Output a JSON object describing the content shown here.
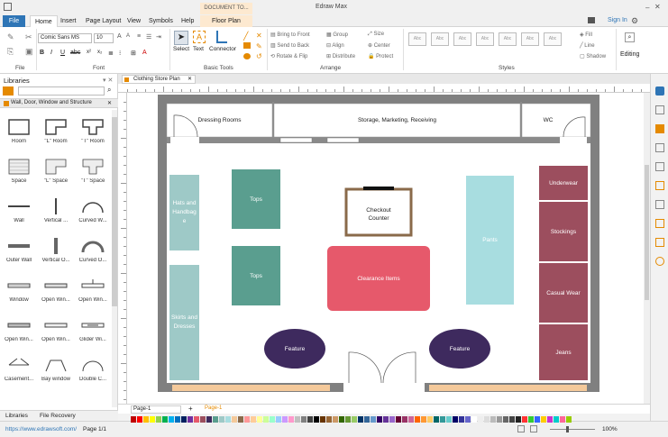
{
  "app": {
    "title": "Edraw Max",
    "context_title": "DOCUMENT TO...",
    "sign_in": "Sign In"
  },
  "menu": {
    "tabs": [
      "File",
      "Home",
      "Insert",
      "Page Layout",
      "View",
      "Symbols",
      "Help",
      "Floor Plan"
    ]
  },
  "ribbon": {
    "font_family": "Comic Sans MS",
    "font_size": "10",
    "tools": {
      "select": "Select",
      "text": "Text",
      "connector": "Connector"
    },
    "arrange": {
      "bring_to_front": "Bring to Front",
      "send_to_back": "Send to Back",
      "rotate_flip": "Rotate & Flip",
      "group": "Group",
      "align": "Align",
      "distribute": "Distribute",
      "size": "Size",
      "center": "Center",
      "protect": "Protect"
    },
    "styles": {
      "fill": "Fill",
      "line": "Line",
      "shadow": "Shadow",
      "style_label": "Abc"
    },
    "editing": "Editing",
    "groups": {
      "file": "File",
      "font": "Font",
      "basic_tools": "Basic Tools",
      "arrange": "Arrange",
      "styles": "Styles"
    }
  },
  "library": {
    "title": "Libraries",
    "category": "Wall, Door, Window and Structure",
    "shapes": [
      {
        "label": "Room"
      },
      {
        "label": "\"L\" Room"
      },
      {
        "label": "\"T\" Room"
      },
      {
        "label": "Space"
      },
      {
        "label": "\"L\" Space"
      },
      {
        "label": "\"T\" Space"
      },
      {
        "label": "Wall"
      },
      {
        "label": "Vertical ..."
      },
      {
        "label": "Curved W..."
      },
      {
        "label": "Outer Wall"
      },
      {
        "label": "Vertical O..."
      },
      {
        "label": "Curved O..."
      },
      {
        "label": "Window"
      },
      {
        "label": "Open Win..."
      },
      {
        "label": "Open Win..."
      },
      {
        "label": "Open Win..."
      },
      {
        "label": "Open Win..."
      },
      {
        "label": "Glider Wi..."
      },
      {
        "label": "Casement..."
      },
      {
        "label": "Bay window"
      },
      {
        "label": "Double C..."
      }
    ],
    "bottom_tabs": {
      "libraries": "Libraries",
      "file_recovery": "File Recovery"
    }
  },
  "document": {
    "tab": "Clothing Store Plan"
  },
  "floorplan": {
    "rooms": {
      "dressing": "Dressing Rooms",
      "storage": "Storage, Marketing, Receiving",
      "wc": "WC"
    },
    "fixtures": {
      "hats": "Hats and Handbag e",
      "skirts": "Skirts and Dresses",
      "tops1": "Tops",
      "tops2": "Tops",
      "checkout": "Checkout Counter",
      "clearance": "Clearance Items",
      "pants": "Pants",
      "feature1": "Feature",
      "feature2": "Feature",
      "underwear": "Underwear",
      "stockings": "Stockings",
      "casual": "Casual Wear",
      "jeans": "Jeans"
    },
    "colors": {
      "teal": "#5a9e8f",
      "light_teal": "#9ec9c7",
      "aqua": "#a8dde0",
      "rose": "#e6596b",
      "plum": "#9c4e5e",
      "feature": "#3e2a5e",
      "wall": "#808080"
    }
  },
  "pages": {
    "current": "Page-1",
    "active": "Page-1"
  },
  "status": {
    "url": "https://www.edrawsoft.com/",
    "page": "Page 1/1",
    "zoom": "100%"
  }
}
